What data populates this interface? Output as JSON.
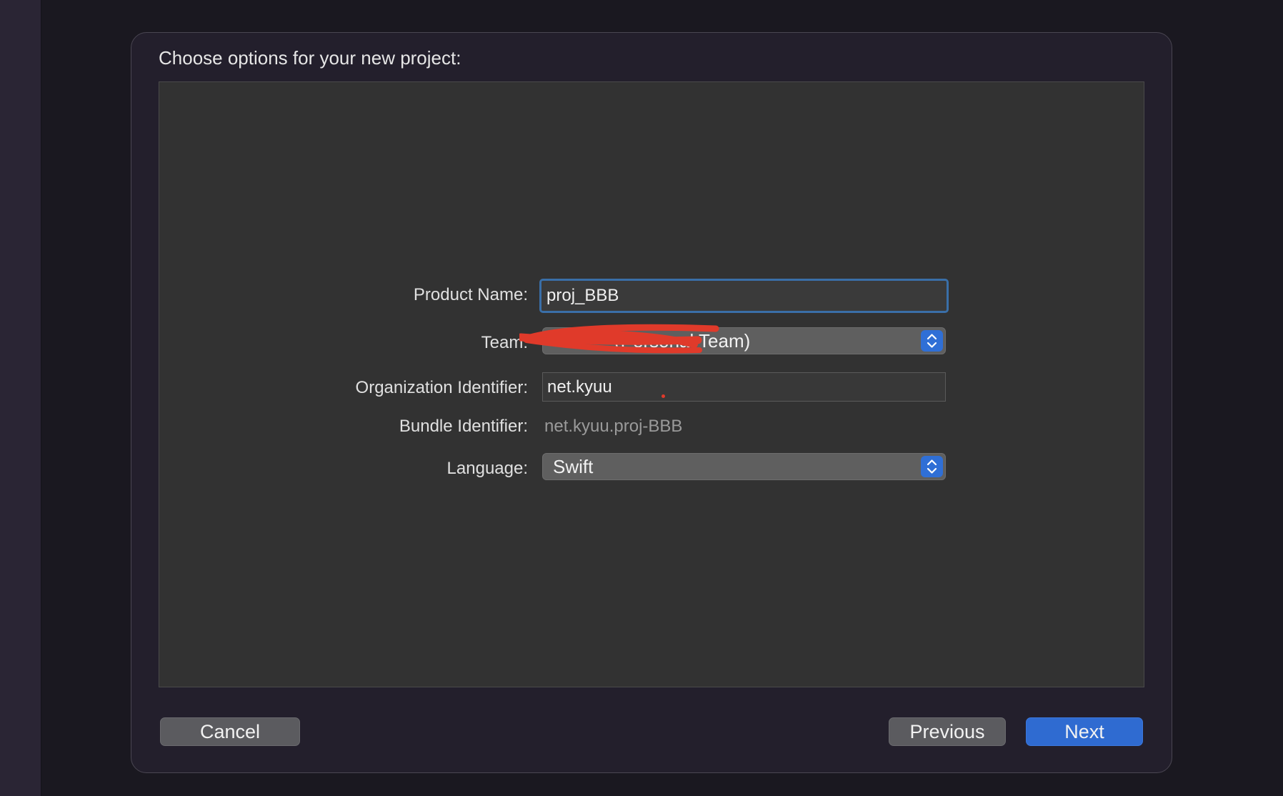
{
  "dialog": {
    "title": "Choose options for your new project:"
  },
  "form": {
    "product_name": {
      "label": "Product Name:",
      "value": "proj_BBB"
    },
    "team": {
      "label": "Team:",
      "value": "(Personal Team)"
    },
    "organization_identifier": {
      "label": "Organization Identifier:",
      "value": "net.kyuu"
    },
    "bundle_identifier": {
      "label": "Bundle Identifier:",
      "value": "net.kyuu.proj-BBB"
    },
    "language": {
      "label": "Language:",
      "value": "Swift"
    }
  },
  "buttons": {
    "cancel": "Cancel",
    "previous": "Previous",
    "next": "Next"
  },
  "colors": {
    "accent": "#2f6bd1",
    "focus_ring": "#3a6fa8",
    "redaction": "#e03a2a"
  },
  "icons": {
    "popup_stepper": "chevron-up-down-icon"
  }
}
